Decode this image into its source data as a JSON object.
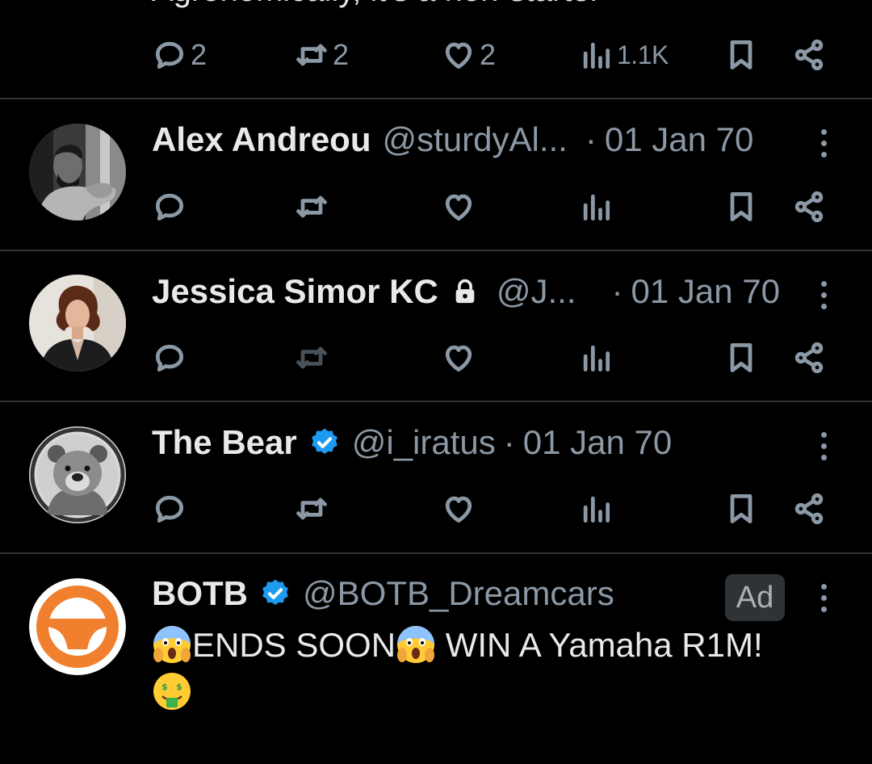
{
  "top_tweet": {
    "snippet": "Agronomically, it's a non-starter",
    "stats": {
      "replies": "2",
      "retweets": "2",
      "likes": "2",
      "views": "1.1K"
    }
  },
  "tweets": [
    {
      "name": "Alex Andreou",
      "handle": "@sturdyAl...",
      "separator": "·",
      "date": "01 Jan 70",
      "avatar": "man-with-beard-photo"
    },
    {
      "name": "Jessica Simor KC",
      "handle": "@J...",
      "separator": "·",
      "date": "01 Jan 70",
      "avatar": "woman-portrait-photo",
      "badge": "lock-icon"
    },
    {
      "name": "The Bear",
      "handle": "@i_iratus",
      "separator": "·",
      "date": "01 Jan 70",
      "avatar": "bear-illustration",
      "badge": "verified-badge-icon"
    }
  ],
  "ad": {
    "name": "BOTB",
    "handle": "@BOTB_Dreamcars",
    "badge_label": "Ad",
    "text_1": "ENDS SOON",
    "text_2": " WIN A Yamaha R1M!",
    "avatar": "steering-wheel-logo"
  },
  "colors": {
    "background": "#000000",
    "text": "#e7e9ea",
    "muted": "#8b98a5",
    "divider": "#2f3336",
    "verified": "#1d9bf0",
    "botb_orange": "#f07f2e"
  }
}
